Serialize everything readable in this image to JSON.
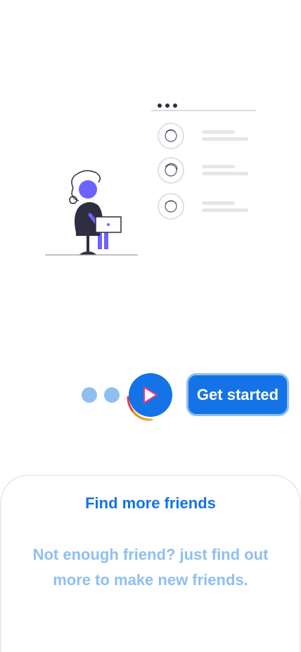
{
  "colors": {
    "primary": "#1473e6",
    "primary_light": "#8fbff2",
    "illustration_accent": "#6c63ff",
    "illustration_dark": "#2f2e41",
    "placeholder_gray": "#e6e6e6",
    "arc_red": "#e53935",
    "arc_yellow": "#f5b31a"
  },
  "illustration": {
    "name": "person-with-laptop-and-friend-list",
    "list_rows": 3
  },
  "pager": {
    "total_pages": 3,
    "current_page": 3,
    "progress": 0.33
  },
  "controls": {
    "play_icon": "play-icon",
    "get_started_label": "Get started"
  },
  "sheet": {
    "title": "Find more friends",
    "body": "Not enough friend? just find out more to make new friends."
  }
}
